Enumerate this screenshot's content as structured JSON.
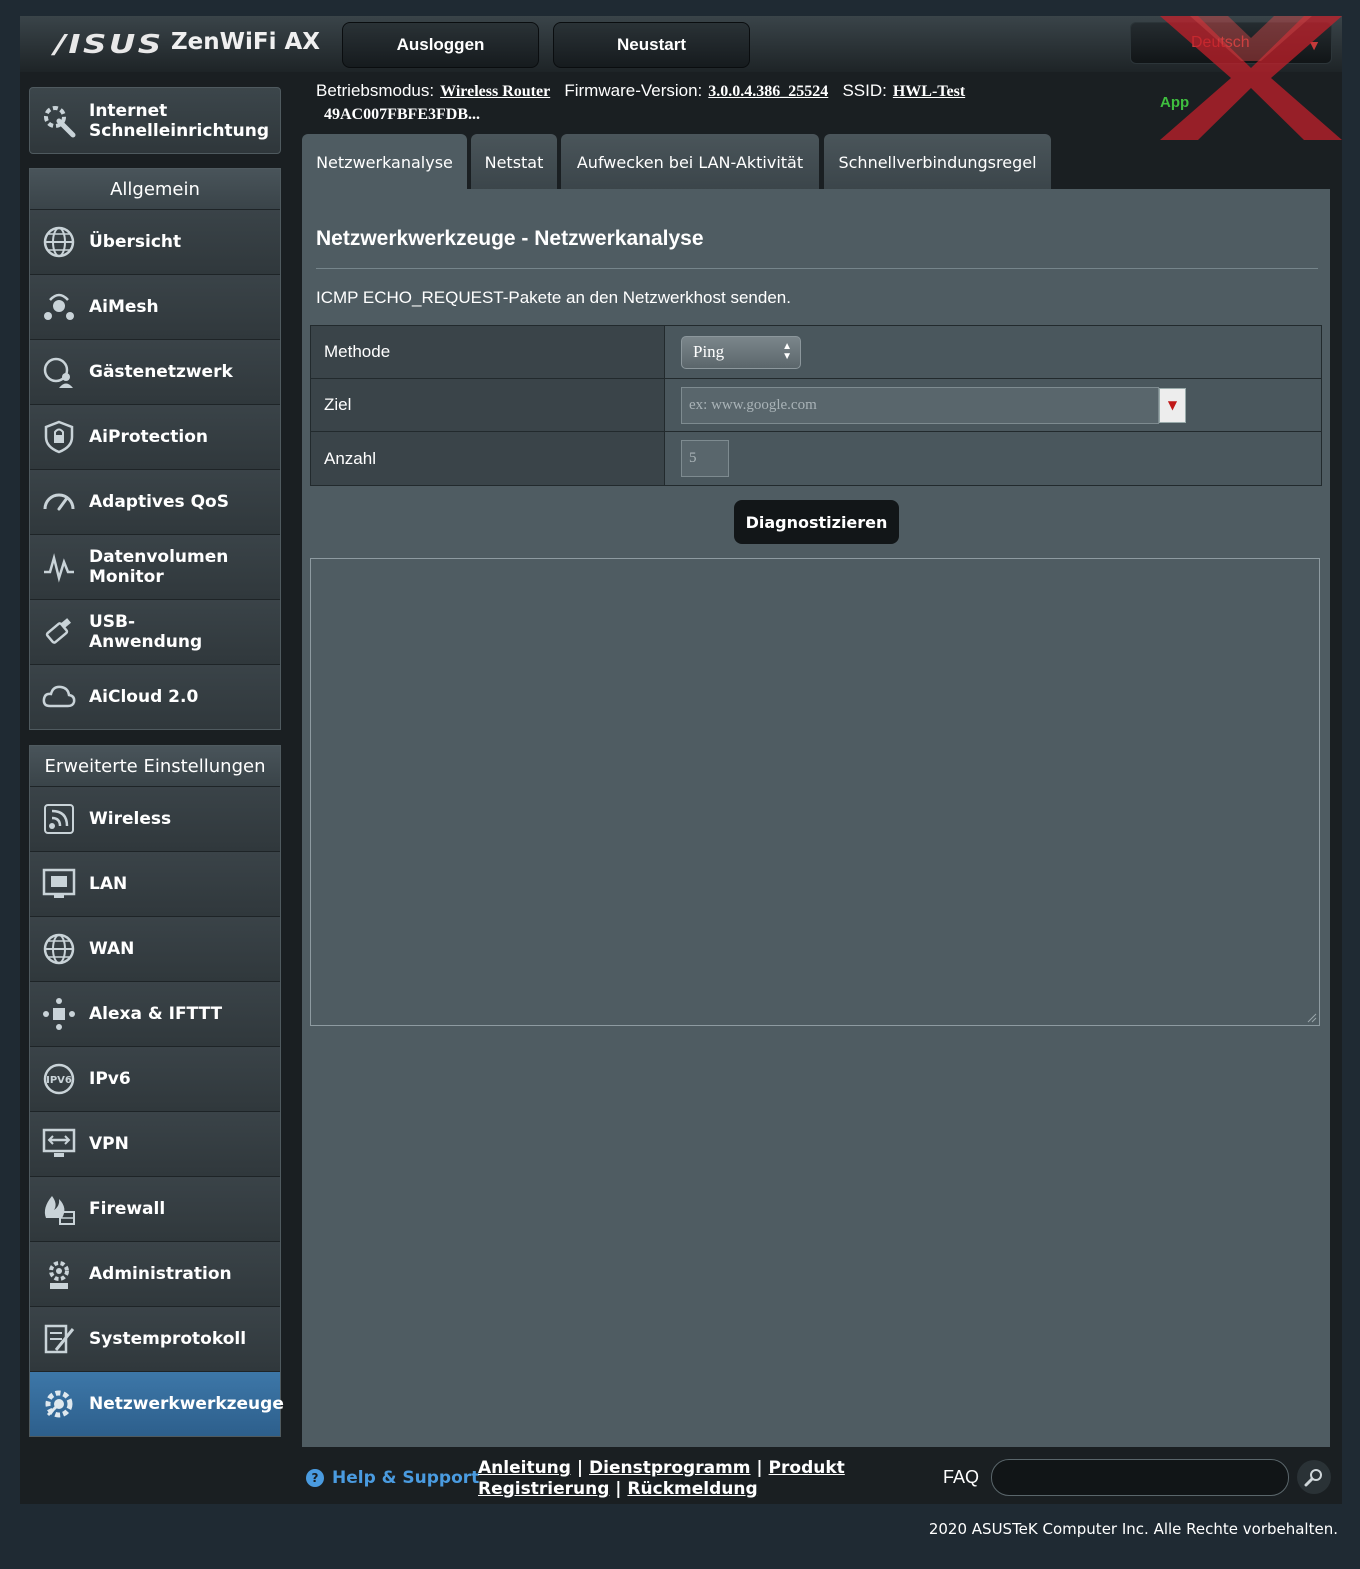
{
  "header": {
    "brand": "/ISUS",
    "model": "ZenWiFi AX",
    "logout_label": "Ausloggen",
    "reboot_label": "Neustart",
    "language": "Deutsch",
    "app_label": "App"
  },
  "status": {
    "mode_label": "Betriebsmodus:",
    "mode_value": "Wireless Router",
    "firmware_label": "Firmware-Version:",
    "firmware_value": "3.0.0.4.386_25524",
    "ssid_label": "SSID:",
    "ssid_value": "HWL-Test",
    "mac": "49AC007FBFE3FDB..."
  },
  "sidebar": {
    "quick_setup": [
      "Internet",
      "Schnelleinrichtung"
    ],
    "general_title": "Allgemein",
    "general_items": [
      {
        "label": "Übersicht",
        "icon": "globe-network-icon"
      },
      {
        "label": "AiMesh",
        "icon": "aimesh-icon"
      },
      {
        "label": "Gästenetzwerk",
        "icon": "guest-network-icon"
      },
      {
        "label": "AiProtection",
        "icon": "shield-lock-icon"
      },
      {
        "label": "Adaptives QoS",
        "icon": "speedometer-icon"
      },
      {
        "label": "Datenvolumen Monitor",
        "icon": "traffic-monitor-icon"
      },
      {
        "label": "USB-Anwendung",
        "icon": "usb-icon"
      },
      {
        "label": "AiCloud 2.0",
        "icon": "cloud-icon"
      }
    ],
    "advanced_title": "Erweiterte Einstellungen",
    "advanced_items": [
      {
        "label": "Wireless",
        "icon": "wireless-icon"
      },
      {
        "label": "LAN",
        "icon": "lan-icon"
      },
      {
        "label": "WAN",
        "icon": "wan-globe-icon"
      },
      {
        "label": "Alexa & IFTTT",
        "icon": "alexa-ifttt-icon"
      },
      {
        "label": "IPv6",
        "icon": "ipv6-icon"
      },
      {
        "label": "VPN",
        "icon": "vpn-icon"
      },
      {
        "label": "Firewall",
        "icon": "firewall-icon"
      },
      {
        "label": "Administration",
        "icon": "admin-gear-icon"
      },
      {
        "label": "Systemprotokoll",
        "icon": "system-log-icon"
      },
      {
        "label": "Netzwerkwerkzeuge",
        "icon": "network-tools-icon",
        "active": true
      }
    ]
  },
  "tabs": [
    "Netzwerkanalyse",
    "Netstat",
    "Aufwecken bei LAN-Aktivität",
    "Schnellverbindungsregel"
  ],
  "main": {
    "title": "Netzwerkwerkzeuge - Netzwerkanalyse",
    "description": "ICMP ECHO_REQUEST-Pakete an den Netzwerkhost senden.",
    "method_label": "Methode",
    "method_value": "Ping",
    "target_label": "Ziel",
    "target_placeholder": "ex: www.google.com",
    "count_label": "Anzahl",
    "count_value": "5",
    "diagnose_label": "Diagnostizieren",
    "output": ""
  },
  "footer": {
    "help_label": "Help & Support",
    "link_manual": "Anleitung",
    "link_utility": "Dienstprogramm",
    "link_product": "Produkt",
    "link_registration": "Registrierung",
    "link_feedback": "Rückmeldung",
    "faq_label": "FAQ",
    "copyright": "2020 ASUSTeK Computer Inc. Alle Rechte vorbehalten."
  },
  "colors": {
    "accent_active": "#2d5f8c",
    "help_blue": "#4a9be0",
    "app_green": "#3fbf3f",
    "language_red": "#c43a3a"
  }
}
